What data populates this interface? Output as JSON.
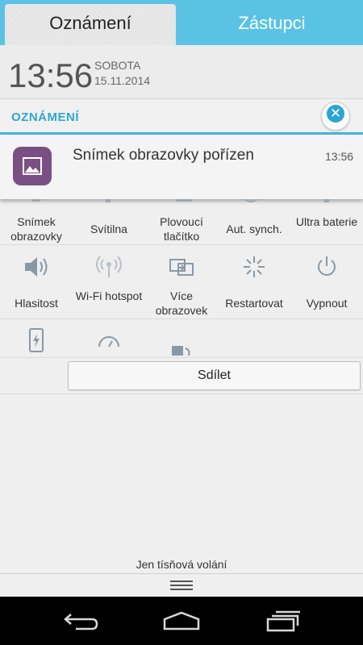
{
  "tabs": [
    {
      "label": "Oznámení",
      "active": true
    },
    {
      "label": "Zástupci",
      "active": false
    }
  ],
  "header": {
    "time": "13:56",
    "day": "SOBOTA",
    "date": "15.11.2014"
  },
  "notifications": {
    "section_title": "OZNÁMENÍ",
    "items": [
      {
        "text": "Snímek obrazovky pořízen",
        "time": "13:56",
        "icon": "image-icon"
      }
    ]
  },
  "toggles": {
    "row1": [
      {
        "label": "Snímek obrazovky",
        "icon": "screenshot-icon"
      },
      {
        "label": "Svítilna",
        "icon": "flashlight-icon"
      },
      {
        "label": "Plovoucí tlačítko",
        "icon": "floating-button-icon"
      },
      {
        "label": "Aut. synch.",
        "icon": "sync-icon"
      },
      {
        "label": "Ultra baterie",
        "icon": "battery-icon"
      }
    ],
    "row2": [
      {
        "label": "Hlasitost",
        "icon": "volume-icon"
      },
      {
        "label": "Wi-Fi hotspot",
        "icon": "wifi-hotspot-icon"
      },
      {
        "label": "Více obrazovek",
        "icon": "multi-screen-icon"
      },
      {
        "label": "Restartovat",
        "icon": "restart-icon"
      },
      {
        "label": "Vypnout",
        "icon": "power-icon"
      }
    ]
  },
  "share_label": "Sdílet",
  "emergency_text": "Jen tísňová volání",
  "colors": {
    "accent": "#3fb5dc",
    "tab_bar": "#5ac3e4",
    "app_icon": "#7a4f84"
  }
}
